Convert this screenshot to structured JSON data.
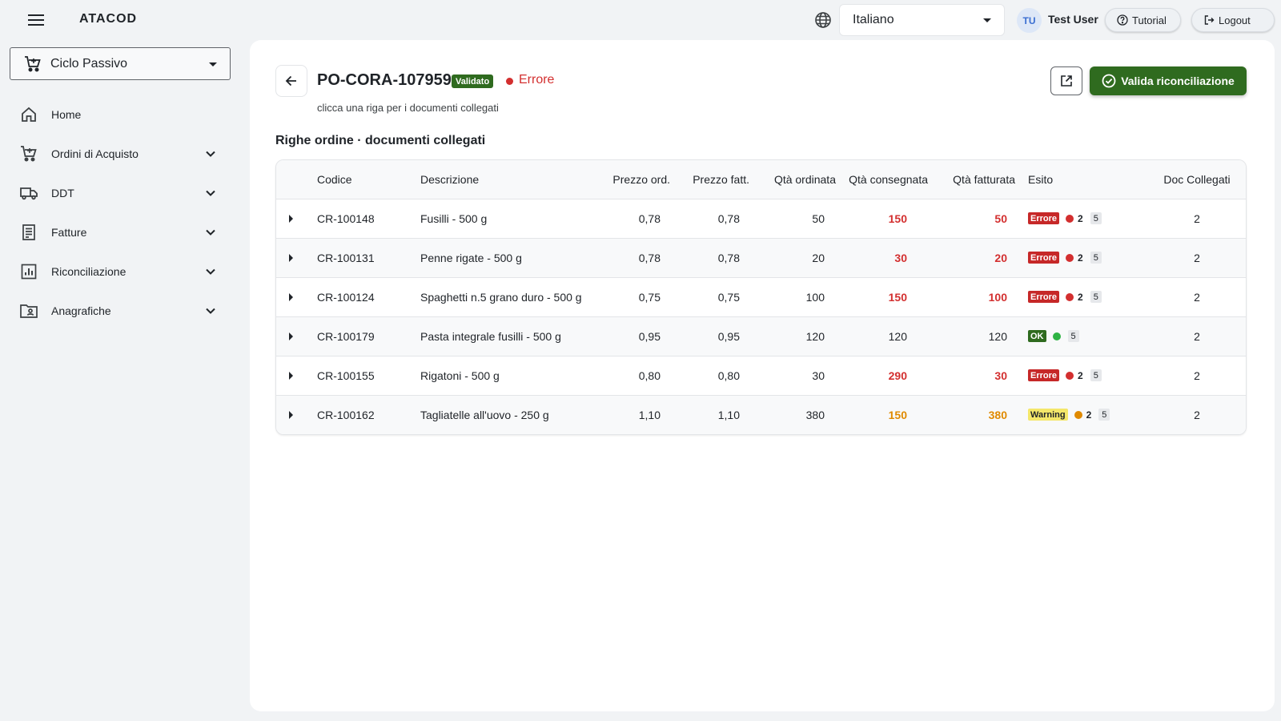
{
  "app": {
    "brand": "ATACOD",
    "language": "Italiano",
    "user_initials": "TU",
    "user_name": "Test User",
    "tutorial_label": "Tutorial",
    "logout_label": "Logout"
  },
  "sidebar": {
    "module": "Ciclo Passivo",
    "items": [
      {
        "label": "Home",
        "icon": "home-icon",
        "expandable": false
      },
      {
        "label": "Ordini di Acquisto",
        "icon": "cart-icon",
        "expandable": true
      },
      {
        "label": "DDT",
        "icon": "truck-icon",
        "expandable": true
      },
      {
        "label": "Fatture",
        "icon": "invoice-icon",
        "expandable": true
      },
      {
        "label": "Riconciliazione",
        "icon": "chart-icon",
        "expandable": true
      },
      {
        "label": "Anagrafiche",
        "icon": "contact-folder-icon",
        "expandable": true
      }
    ]
  },
  "header": {
    "po_code": "PO-CORA-107959",
    "validated_badge": "Validato",
    "status": "Errore",
    "subtitle": "clicca una riga per i documenti collegati",
    "validate_label": "Valida riconciliazione"
  },
  "section_title": "Righe ordine · documenti collegati",
  "table": {
    "columns": [
      "Codice",
      "Descrizione",
      "Prezzo ord.",
      "Prezzo fatt.",
      "Qtà ordinata",
      "Qtà consegnata",
      "Qtà fatturata",
      "Esito",
      "Doc Collegati"
    ],
    "rows": [
      {
        "codice": "CR-100148",
        "descrizione": "Fusilli - 500 g",
        "prezzo_ord": "0,78",
        "prezzo_fatt": "0,78",
        "qta_ord": "50",
        "qta_cons": "150",
        "qta_fatt": "50",
        "esito": "Errore",
        "esito_count": "2",
        "esito_chip": "5",
        "doc": "2",
        "level": "error"
      },
      {
        "codice": "CR-100131",
        "descrizione": "Penne rigate - 500 g",
        "prezzo_ord": "0,78",
        "prezzo_fatt": "0,78",
        "qta_ord": "20",
        "qta_cons": "30",
        "qta_fatt": "20",
        "esito": "Errore",
        "esito_count": "2",
        "esito_chip": "5",
        "doc": "2",
        "level": "error"
      },
      {
        "codice": "CR-100124",
        "descrizione": "Spaghetti n.5 grano duro - 500 g",
        "prezzo_ord": "0,75",
        "prezzo_fatt": "0,75",
        "qta_ord": "100",
        "qta_cons": "150",
        "qta_fatt": "100",
        "esito": "Errore",
        "esito_count": "2",
        "esito_chip": "5",
        "doc": "2",
        "level": "error"
      },
      {
        "codice": "CR-100179",
        "descrizione": "Pasta integrale fusilli - 500 g",
        "prezzo_ord": "0,95",
        "prezzo_fatt": "0,95",
        "qta_ord": "120",
        "qta_cons": "120",
        "qta_fatt": "120",
        "esito": "OK",
        "esito_count": "",
        "esito_chip": "5",
        "doc": "2",
        "level": "ok"
      },
      {
        "codice": "CR-100155",
        "descrizione": "Rigatoni - 500 g",
        "prezzo_ord": "0,80",
        "prezzo_fatt": "0,80",
        "qta_ord": "30",
        "qta_cons": "290",
        "qta_fatt": "30",
        "esito": "Errore",
        "esito_count": "2",
        "esito_chip": "5",
        "doc": "2",
        "level": "error"
      },
      {
        "codice": "CR-100162",
        "descrizione": "Tagliatelle all'uovo - 250 g",
        "prezzo_ord": "1,10",
        "prezzo_fatt": "1,10",
        "qta_ord": "380",
        "qta_cons": "150",
        "qta_fatt": "380",
        "esito": "Warning",
        "esito_count": "2",
        "esito_chip": "5",
        "doc": "2",
        "level": "warning"
      }
    ]
  },
  "colors": {
    "accent_green": "#2f6b1f",
    "error_red": "#d32f2f",
    "warning_orange": "#e08a00",
    "ok_green": "#2fb344"
  }
}
